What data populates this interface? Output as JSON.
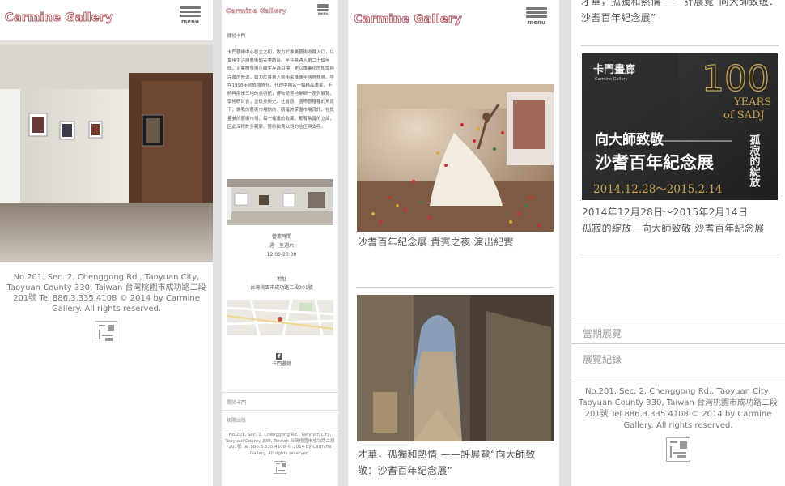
{
  "brand": {
    "logo": "Carmine Gallery",
    "menu_label": "menu"
  },
  "footer": {
    "address": "No.201, Sec. 2, Chenggong Rd., Taoyuan City, Taoyuan County 330, Taiwan  台灣桃園市成功路二段201號  Tel 886.3.335.4108  © 2014 by Carmine Gallery. All rights reserved."
  },
  "panel2": {
    "about_title": "關於卡門",
    "about_body": "卡門藝術中心創立之初，致力於推廣藝術收藏入口，以實現生活與藝術的完美結合。至今將邁入第二十個年頭，企業體發展永續生存為目標，更以專業化的知識與完善的營運，致力於將華人藝術家推廣至國際藝壇。早在1998年就成國際化，代理中國名一幅精品畫家，不時再兩岸三地的美術館，博物館等地舉辦一系列展覽、學術研討會，並從美術史、社會觀、國際觀種種的角度下，讓我的藝術市場動向，精確的掌握市場資訊，在質量兼的藝術市場，每一幅畫的收藏，都有紮實的立論，因此深得許多藏家、藝術拍賣公司的信任與支持。",
    "hours_label": "營業時間",
    "hours_days": "週一至週六",
    "hours_time": "12:00-20:00",
    "address_label": "地址",
    "address_value": "台灣桃園市成功路二段201號",
    "facebook_label": "卡門畫廊",
    "nav": [
      "關於卡門",
      "相關出版"
    ]
  },
  "panel3": {
    "captions": [
      "沙耆百年紀念展 貴賓之夜 演出紀實",
      "才華，孤獨和熱情 ——評展覽“向大師致敬：沙耆百年紀念展”"
    ]
  },
  "panel4": {
    "top_caption": "才華，孤獨和熱情 ——評展覽“向大師致敬：沙耆百年紀念展”",
    "poster": {
      "brand_cn": "卡門畫廊",
      "brand_en": "Carmine Gallery",
      "years_num": "100",
      "years_text": "YEARS",
      "years_of": "of SADJ",
      "title_small": "向大師致敬",
      "title_big": "沙耆百年紀念展",
      "side_text": "孤寂的綻放",
      "dates": "2014.12.28～2015.2.14"
    },
    "date_text": "2014年12月28日～2015年2月14日",
    "subtitle": "孤寂的綻放一向大師致敬 沙耆百年紀念展",
    "nav": [
      "當期展覽",
      "展覽紀錄"
    ]
  },
  "colors": {
    "logo_outline": "#b05a62",
    "gap": "#e1e1e1",
    "divider": "#d0d0d0"
  }
}
